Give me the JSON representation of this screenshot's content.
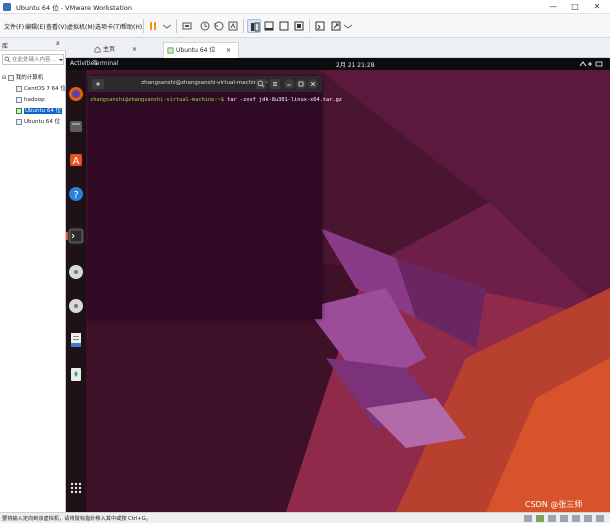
{
  "window": {
    "title": "Ubuntu 64 位 - VMware Workstation",
    "controls": [
      "—",
      "□",
      "✕"
    ]
  },
  "menu": [
    "文件(F)",
    "编辑(E)",
    "查看(V)",
    "虚拟机(M)",
    "选项卡(T)",
    "帮助(H)"
  ],
  "library": {
    "title": "库",
    "close": "x",
    "search_placeholder": "在此处键入内容...",
    "root": "我的计算机",
    "items": [
      "CentOS 7 64 位",
      "hadoop",
      "Ubuntu 64 位",
      "Ubuntu 64 位"
    ],
    "selected_index": 2
  },
  "tabs": [
    {
      "label": "主页"
    },
    {
      "label": "Ubuntu 64 位"
    }
  ],
  "guest": {
    "activities": "Activities",
    "app": "Terminal",
    "clock": "2月 21  21:28",
    "terminal": {
      "title": "zhangsanshi@zhangsanshi-virtual-machine: ~",
      "prompt": "zhangsanshi@zhangsanshi-virtual-machine:~$",
      "command": " tar -zxvf jdk-8u301-linux-x64.tar.gz"
    }
  },
  "status": {
    "text": "要将输入定向到该虚拟机，请将鼠标指针移入其中或按 Ctrl+G。",
    "watermark": "CSDN @张三师"
  },
  "colors": {
    "accent": "#0f63c8",
    "terminal_bg": "#300a24",
    "prompt": "#8ae234",
    "wallpaper": "#7a2352"
  }
}
